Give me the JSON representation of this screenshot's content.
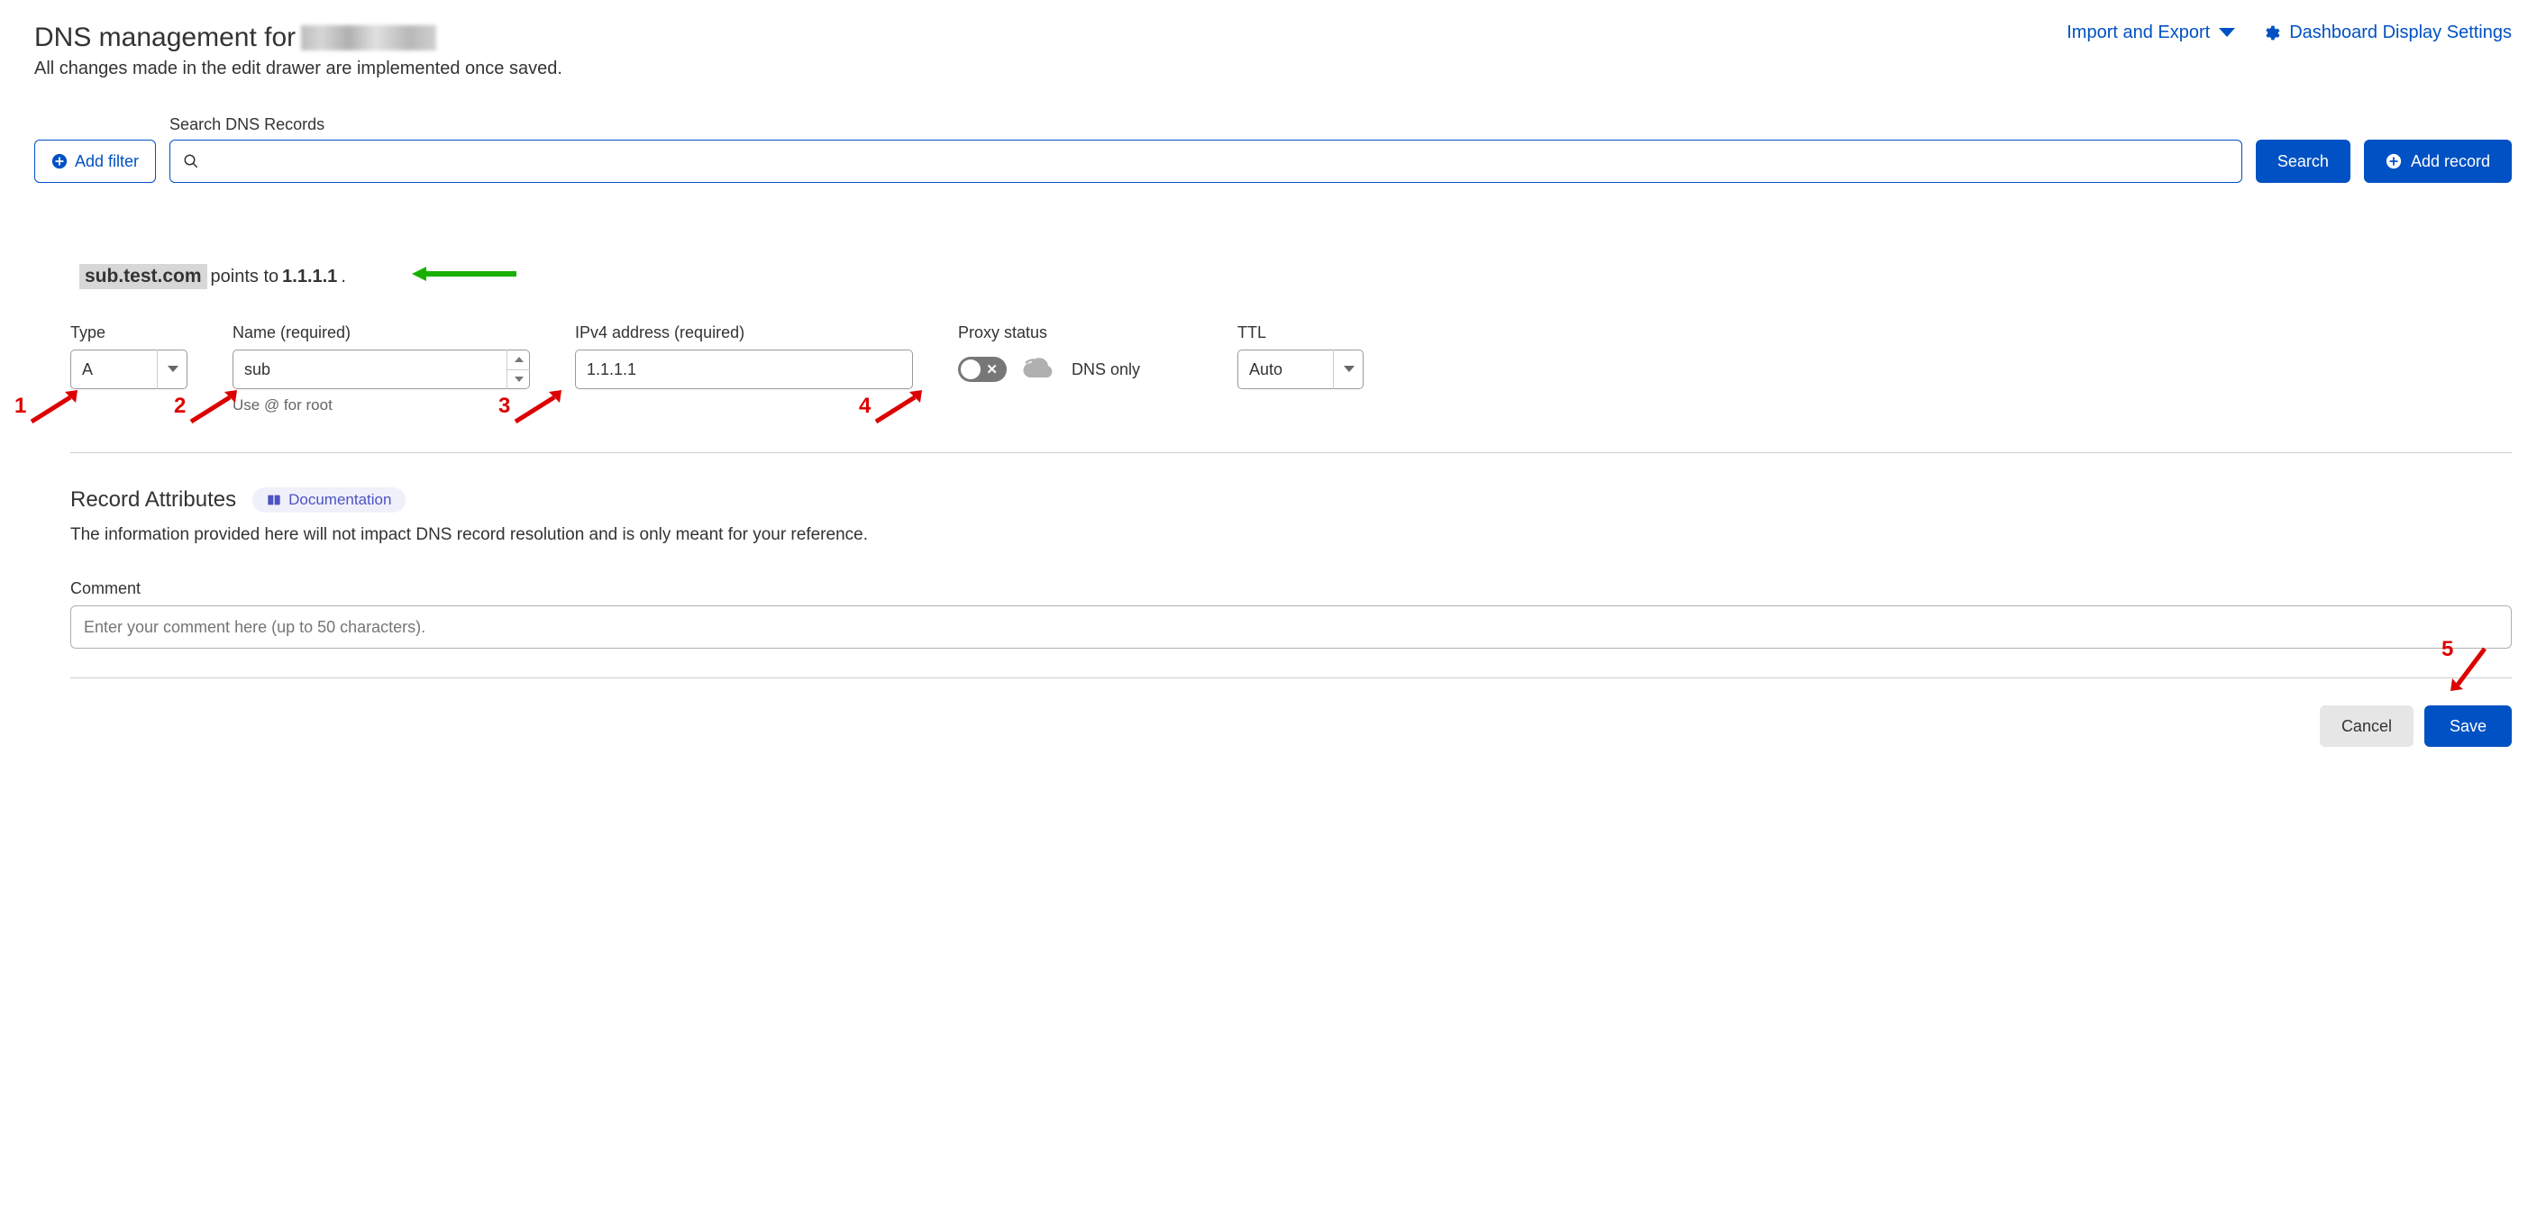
{
  "header": {
    "title_prefix": "DNS management for",
    "subtitle": "All changes made in the edit drawer are implemented once saved."
  },
  "top_actions": {
    "import_export": "Import and Export",
    "dashboard_settings": "Dashboard Display Settings"
  },
  "toolbar": {
    "add_filter": "Add filter",
    "search_label": "Search DNS Records",
    "search_value": "",
    "search_button": "Search",
    "add_record": "Add record"
  },
  "record_summary": {
    "domain_text": "sub.test.com",
    "middle": " points to ",
    "ip_text": "1.1.1.1",
    "tail": "."
  },
  "fields": {
    "type_label": "Type",
    "type_value": "A",
    "name_label": "Name (required)",
    "name_value": "sub",
    "name_helper": "Use @ for root",
    "ip_label": "IPv4 address (required)",
    "ip_value": "1.1.1.1",
    "proxy_label": "Proxy status",
    "proxy_text": "DNS only",
    "ttl_label": "TTL",
    "ttl_value": "Auto"
  },
  "attributes": {
    "heading": "Record Attributes",
    "doc_link": "Documentation",
    "subtext": "The information provided here will not impact DNS record resolution and is only meant for your reference.",
    "comment_label": "Comment",
    "comment_placeholder": "Enter your comment here (up to 50 characters)."
  },
  "footer": {
    "cancel": "Cancel",
    "save": "Save"
  },
  "annotations": {
    "n1": "1",
    "n2": "2",
    "n3": "3",
    "n4": "4",
    "n5": "5"
  }
}
